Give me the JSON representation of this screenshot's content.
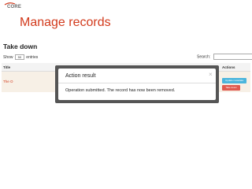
{
  "logo": {
    "text": "CORE",
    "icon": "swoosh-logo"
  },
  "page": {
    "title": "Manage records",
    "subtitle": "Take down"
  },
  "table_controls": {
    "show_label": "Show",
    "show_value": "50",
    "entries_label": "entries",
    "search_label": "Search:",
    "search_value": ""
  },
  "table": {
    "headers": {
      "title": "Title",
      "actions": "Actions"
    },
    "rows": [
      {
        "title": "The O",
        "update_label": "Update metadata",
        "takedown_label": "Take down"
      }
    ]
  },
  "modal": {
    "title": "Action result",
    "close_symbol": "×",
    "message": "Operation submitted. The record has now been removed."
  },
  "colors": {
    "title": "#d23a1c",
    "update_button": "#4bb5dc",
    "takedown_button": "#e05a4f",
    "modal_frame": "#555555"
  }
}
